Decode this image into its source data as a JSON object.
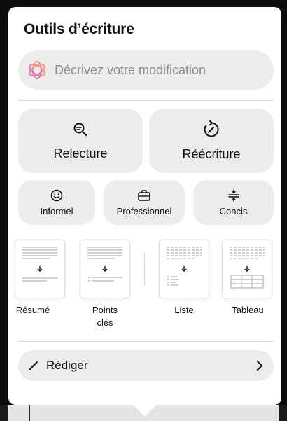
{
  "panel": {
    "title": "Outils d’écriture"
  },
  "prompt": {
    "placeholder": "Décrivez votre modification",
    "icon": "sparkle-flower-icon"
  },
  "main_actions": [
    {
      "label": "Relecture",
      "icon": "magnifier-icon"
    },
    {
      "label": "Réécriture",
      "icon": "rewrite-arrow-icon"
    }
  ],
  "tone_actions": [
    {
      "label": "Informel",
      "icon": "smiley-icon"
    },
    {
      "label": "Professionnel",
      "icon": "briefcase-icon"
    },
    {
      "label": "Concis",
      "icon": "divide-icon"
    }
  ],
  "format_actions": [
    {
      "label": "Résumé",
      "icon": "summary-doc-icon"
    },
    {
      "label": "Points clés",
      "icon": "key-points-doc-icon"
    },
    {
      "label": "Liste",
      "icon": "list-doc-icon"
    },
    {
      "label": "Tableau",
      "icon": "table-doc-icon"
    }
  ],
  "compose": {
    "label": "Rédiger",
    "icon": "pencil-icon",
    "chevron": "chevron-right-icon"
  },
  "colors": {
    "panel_bg": "#ffffff",
    "button_bg": "#ececec",
    "placeholder": "#8c8c8c",
    "sparkle_start": "#f4a36b",
    "sparkle_end": "#c86bd8"
  }
}
